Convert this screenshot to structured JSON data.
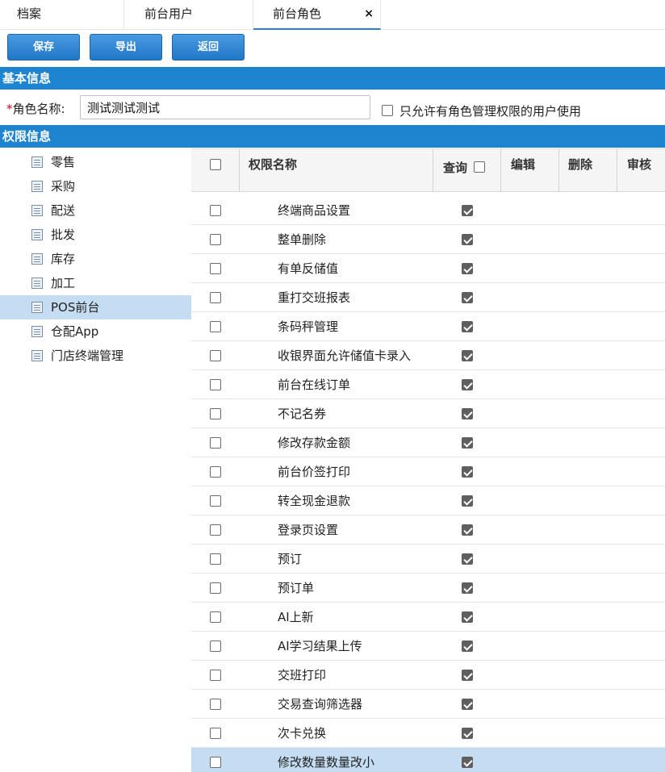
{
  "tabs": [
    {
      "label": "档案"
    },
    {
      "label": "前台用户"
    },
    {
      "label": "前台角色",
      "close": "×"
    }
  ],
  "toolbar": {
    "save": "保存",
    "export": "导出",
    "back": "返回"
  },
  "sections": {
    "basic": "基本信息",
    "permission": "权限信息"
  },
  "basic": {
    "required_mark": "*",
    "role_label": "角色名称:",
    "role_value": "测试测试测试",
    "only_role_label": "只允许有角色管理权限的用户使用",
    "only_role_checked": false
  },
  "tree": {
    "items": [
      {
        "label": "零售"
      },
      {
        "label": "采购"
      },
      {
        "label": "配送"
      },
      {
        "label": "批发"
      },
      {
        "label": "库存"
      },
      {
        "label": "加工"
      },
      {
        "label": "POS前台",
        "selected": true
      },
      {
        "label": "仓配App"
      },
      {
        "label": "门店终端管理"
      }
    ]
  },
  "grid": {
    "headers": {
      "name": "权限名称",
      "query": "查询",
      "edit": "编辑",
      "delete": "删除",
      "audit": "审核"
    },
    "rows": [
      {
        "name": "终端商品设置",
        "query": true
      },
      {
        "name": "整单删除",
        "query": true
      },
      {
        "name": "有单反储值",
        "query": true
      },
      {
        "name": "重打交班报表",
        "query": true
      },
      {
        "name": "条码秤管理",
        "query": true
      },
      {
        "name": "收银界面允许储值卡录入",
        "query": true
      },
      {
        "name": "前台在线订单",
        "query": true
      },
      {
        "name": "不记名券",
        "query": true
      },
      {
        "name": "修改存款金额",
        "query": true
      },
      {
        "name": "前台价签打印",
        "query": true
      },
      {
        "name": "转全现金退款",
        "query": true
      },
      {
        "name": "登录页设置",
        "query": true
      },
      {
        "name": "预订",
        "query": true
      },
      {
        "name": "预订单",
        "query": true
      },
      {
        "name": "AI上新",
        "query": true
      },
      {
        "name": "AI学习结果上传",
        "query": true
      },
      {
        "name": "交班打印",
        "query": true
      },
      {
        "name": "交易查询筛选器",
        "query": true
      },
      {
        "name": "次卡兑换",
        "query": true
      },
      {
        "name": "修改数量数量改小",
        "query": true,
        "selected": true
      }
    ]
  },
  "colors": {
    "accent": "#1e84d0",
    "selection": "#c4ddf2",
    "button": "#2a82d0"
  }
}
